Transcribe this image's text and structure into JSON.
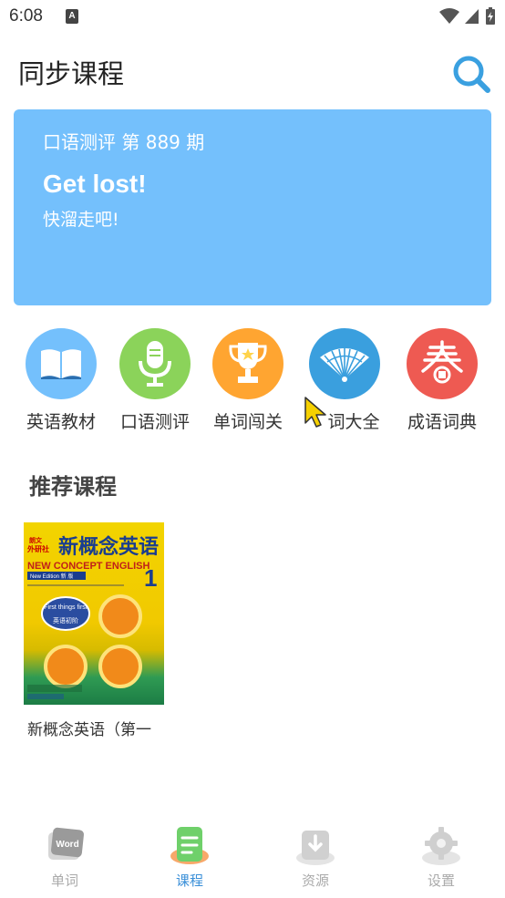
{
  "status_bar": {
    "time": "6:08",
    "notification_icon": "A"
  },
  "header": {
    "title": "同步课程",
    "search_icon": "search-icon"
  },
  "banner": {
    "issue": "口语测评 第 889 期",
    "english": "Get lost!",
    "chinese": "快溜走吧!",
    "color": "#74c0fc"
  },
  "categories": [
    {
      "label": "英语教材",
      "icon": "book-icon",
      "color": "#74c0fc"
    },
    {
      "label": "口语测评",
      "icon": "microphone-icon",
      "color": "#8bd35a"
    },
    {
      "label": "单词闯关",
      "icon": "trophy-icon",
      "color": "#ffa531"
    },
    {
      "label": "词大全",
      "icon": "fan-icon",
      "color": "#3a9fde"
    },
    {
      "label": "成语词典",
      "icon": "spring-seal-icon",
      "color": "#ee5a52"
    }
  ],
  "recommend": {
    "title": "推荐课程",
    "courses": [
      {
        "name": "新概念英语（第一",
        "cover_title": "新概念英语",
        "cover_subtitle": "NEW CONCEPT ENGLISH",
        "cover_number": "1",
        "cover_badge": "First things first",
        "cover_badge_cn": "英语初阶",
        "cover_publisher_top": "朗文",
        "cover_publisher": "外研社",
        "cover_edition": "New Edition 新 版"
      }
    ]
  },
  "bottom_nav": {
    "items": [
      {
        "label": "单词",
        "icon": "word-card-icon",
        "active": false
      },
      {
        "label": "课程",
        "icon": "course-list-icon",
        "active": true
      },
      {
        "label": "资源",
        "icon": "download-icon",
        "active": false
      },
      {
        "label": "设置",
        "icon": "gear-icon",
        "active": false
      }
    ],
    "active_color": "#3a8fd8",
    "inactive_color": "#aaaaaa"
  }
}
